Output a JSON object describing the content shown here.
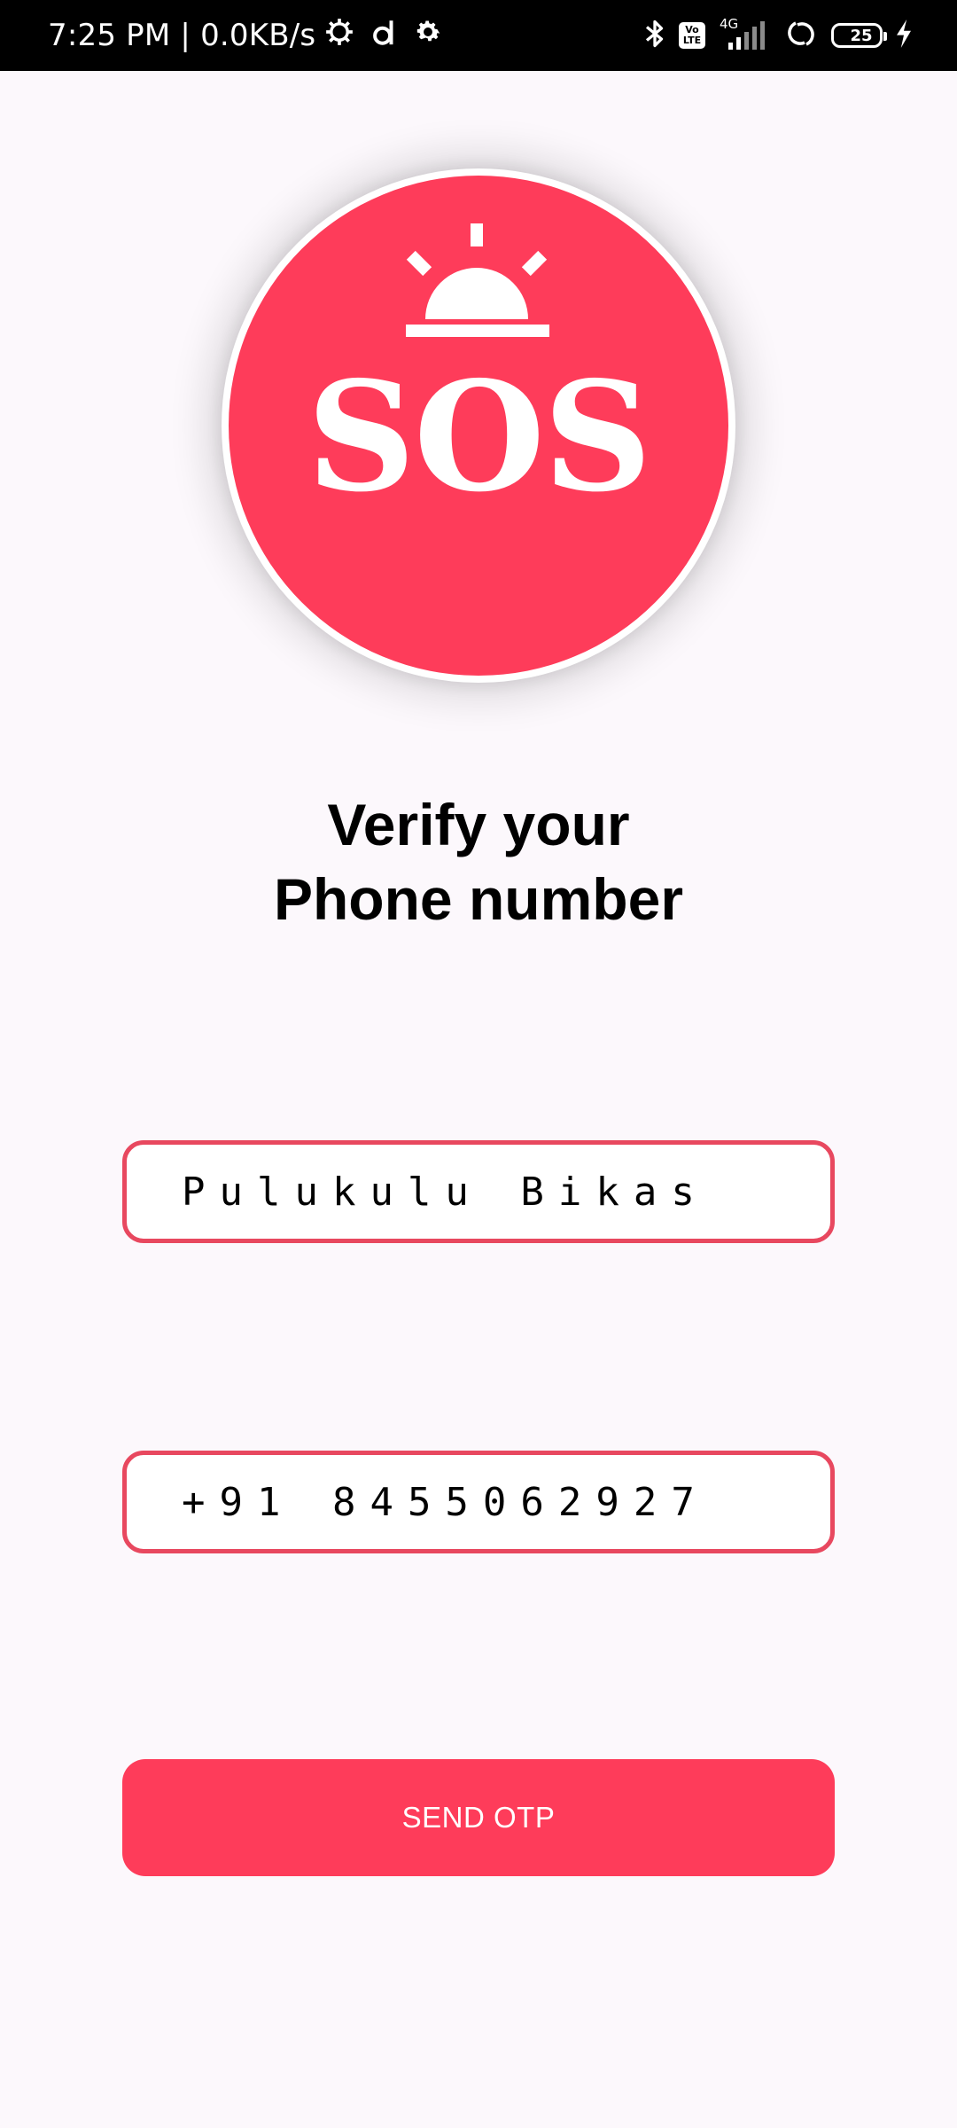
{
  "status_bar": {
    "time_speed": "7:25 PM | 0.0KB/s",
    "network_type": "4G",
    "volte_label_top": "Vo",
    "volte_label_bottom": "LTE",
    "battery_level": "25",
    "icons": [
      "settings-gear-icon",
      "d-app-icon",
      "gear-icon",
      "bluetooth-icon",
      "volte-icon",
      "signal-icon",
      "hotspot-icon",
      "battery-icon",
      "charging-icon"
    ]
  },
  "logo": {
    "text": "SOS",
    "color": "#fe3c5a"
  },
  "heading": {
    "line1": "Verify your",
    "line2": "Phone number"
  },
  "form": {
    "name_value": "Pulukulu Bikas",
    "phone_value": "+91 8455062927",
    "send_label": "SEND OTP"
  },
  "colors": {
    "accent": "#fe3c5a",
    "field_border": "#e8485f",
    "background": "#fcf8fc"
  }
}
